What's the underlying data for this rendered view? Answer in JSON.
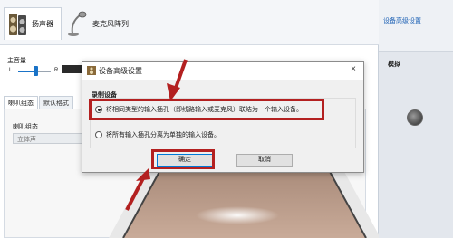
{
  "window": {
    "tabs": [
      {
        "label": "扬声器",
        "icon": "speaker-icon",
        "active": true
      },
      {
        "label": "麦克风阵列",
        "icon": "microphone-icon",
        "active": false
      }
    ],
    "main_volume": {
      "label": "主音量",
      "left": "L",
      "right": "R",
      "level": 0.5
    },
    "sub_tabs": [
      "喇叭组态",
      "默认格式"
    ],
    "config": {
      "label": "喇叭组态",
      "value": "立体声"
    }
  },
  "right_panel": {
    "advanced_link": "设备高级设置",
    "simulate_label": "模拟"
  },
  "dialog": {
    "title": "设备高级设置",
    "close": "×",
    "group_label": "录制设备",
    "options": [
      {
        "label": "将相同类型的输入插孔（即线路输入或麦克风）联结为一个输入设备。",
        "selected": true
      },
      {
        "label": "将所有输入插孔分离为单独的输入设备。",
        "selected": false
      }
    ],
    "ok_label": "确定",
    "cancel_label": "取消"
  },
  "colors": {
    "highlight_red": "#b32020",
    "accent_blue": "#1a73c7",
    "link_blue": "#1a5fb4"
  }
}
